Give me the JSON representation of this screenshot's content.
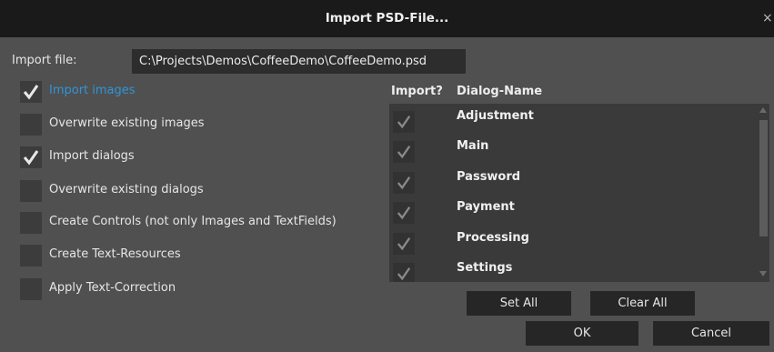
{
  "window": {
    "title": "Import PSD-File...",
    "close_glyph": "×"
  },
  "import_file": {
    "label": "Import file:",
    "value": "C:\\Projects\\Demos\\CoffeeDemo\\CoffeeDemo.psd"
  },
  "options": [
    {
      "label": "Import images",
      "checked": true,
      "highlighted": true
    },
    {
      "label": "Overwrite existing images",
      "checked": false
    },
    {
      "label": "Import dialogs",
      "checked": true
    },
    {
      "label": "Overwrite existing dialogs",
      "checked": false
    },
    {
      "label": "Create Controls (not only Images and TextFields)",
      "checked": false
    },
    {
      "label": "Create Text-Resources",
      "checked": false
    },
    {
      "label": "Apply Text-Correction",
      "checked": false
    }
  ],
  "dialog_list": {
    "headers": {
      "import": "Import?",
      "name": "Dialog-Name"
    },
    "rows": [
      {
        "name": "Adjustment",
        "checked": true
      },
      {
        "name": "Main",
        "checked": true
      },
      {
        "name": "Password",
        "checked": true
      },
      {
        "name": "Payment",
        "checked": true
      },
      {
        "name": "Processing",
        "checked": true
      },
      {
        "name": "Settings",
        "checked": true
      }
    ]
  },
  "buttons": {
    "set_all": "Set All",
    "clear_all": "Clear All",
    "ok": "OK",
    "cancel": "Cancel"
  },
  "colors": {
    "background": "#505050",
    "titlebar": "#1a1a1a",
    "accent": "#2f95d6",
    "checkmark": "#e8e8e8",
    "checkmark_dim": "#8a8a8a"
  },
  "icons": {
    "checkbox_mark": "checkmark-icon",
    "close": "close-icon"
  }
}
